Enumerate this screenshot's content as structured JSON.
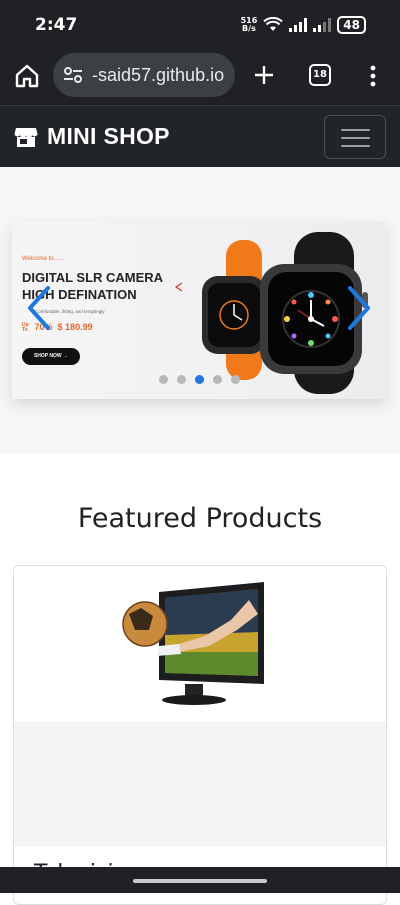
{
  "status_bar": {
    "time": "2:47",
    "net_speed_value": "516",
    "net_speed_unit": "B/s",
    "battery": "48"
  },
  "browser": {
    "url": "-said57.github.io",
    "tab_count": "18"
  },
  "navbar": {
    "brand": "MINI SHOP"
  },
  "carousel": {
    "kicker": "Welcome to......",
    "title_line1": "DIGITAL SLR CAMERA",
    "title_line2": "HIGH DEFINATION",
    "subtitle": "Comfortable, fitting, and temptingly",
    "upto": "Up To",
    "discount": "70%",
    "price": "$ 180.99",
    "cta": "SHOP NOW →",
    "indicator_count": 5,
    "active_index": 2
  },
  "featured": {
    "heading": "Featured Products",
    "products": [
      {
        "name": "Television"
      }
    ]
  },
  "colors": {
    "accent_blue": "#1f78e0",
    "accent_orange": "#e0652a",
    "navbar": "#212529",
    "browser_chrome": "#202124"
  }
}
